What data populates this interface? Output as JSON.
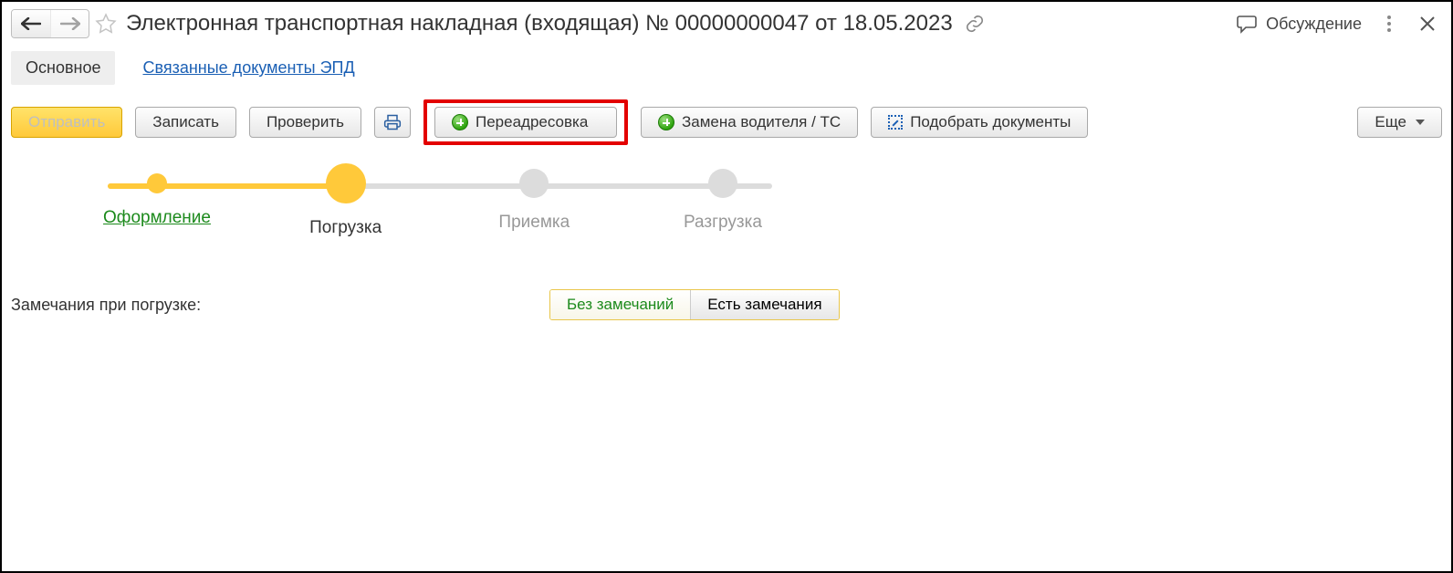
{
  "header": {
    "title": "Электронная транспортная накладная (входящая) № 00000000047 от 18.05.2023",
    "discussion_label": "Обсуждение"
  },
  "tabs": {
    "main": "Основное",
    "linked": "Связанные документы ЭПД"
  },
  "toolbar": {
    "send": "Отправить",
    "save": "Записать",
    "check": "Проверить",
    "reroute": "Переадресовка",
    "change_driver": "Замена водителя / ТС",
    "pick_docs": "Подобрать документы",
    "more": "Еще"
  },
  "steps": [
    {
      "label": "Оформление",
      "state": "done"
    },
    {
      "label": "Погрузка",
      "state": "current"
    },
    {
      "label": "Приемка",
      "state": "future"
    },
    {
      "label": "Разгрузка",
      "state": "future"
    }
  ],
  "remarks": {
    "label": "Замечания при погрузке:",
    "none": "Без замечаний",
    "has": "Есть замечания"
  }
}
